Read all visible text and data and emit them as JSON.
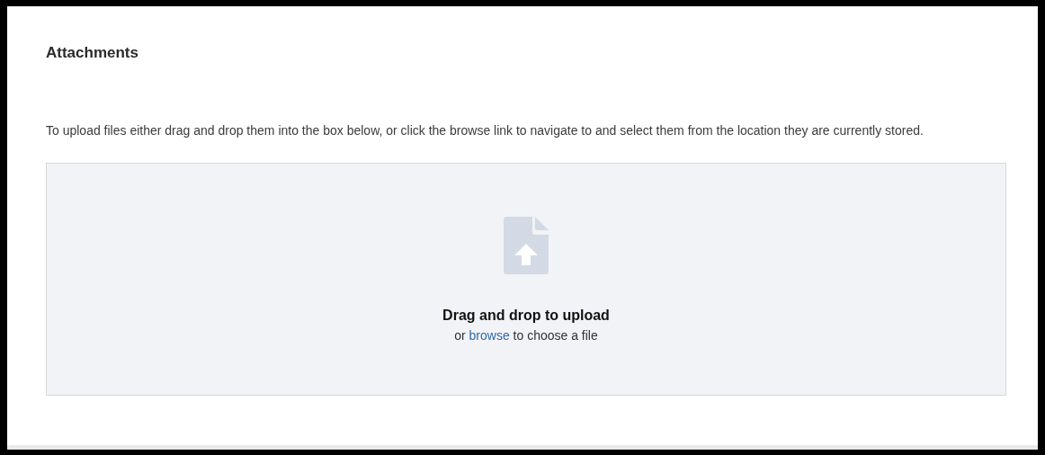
{
  "section": {
    "title": "Attachments"
  },
  "instructions": "To upload files either drag and drop them into the box below, or click the browse link to navigate to and select them from the location they are currently stored.",
  "drop_zone": {
    "heading": "Drag and drop to upload",
    "prefix": "or",
    "link": "browse",
    "suffix": "to choose a file"
  }
}
